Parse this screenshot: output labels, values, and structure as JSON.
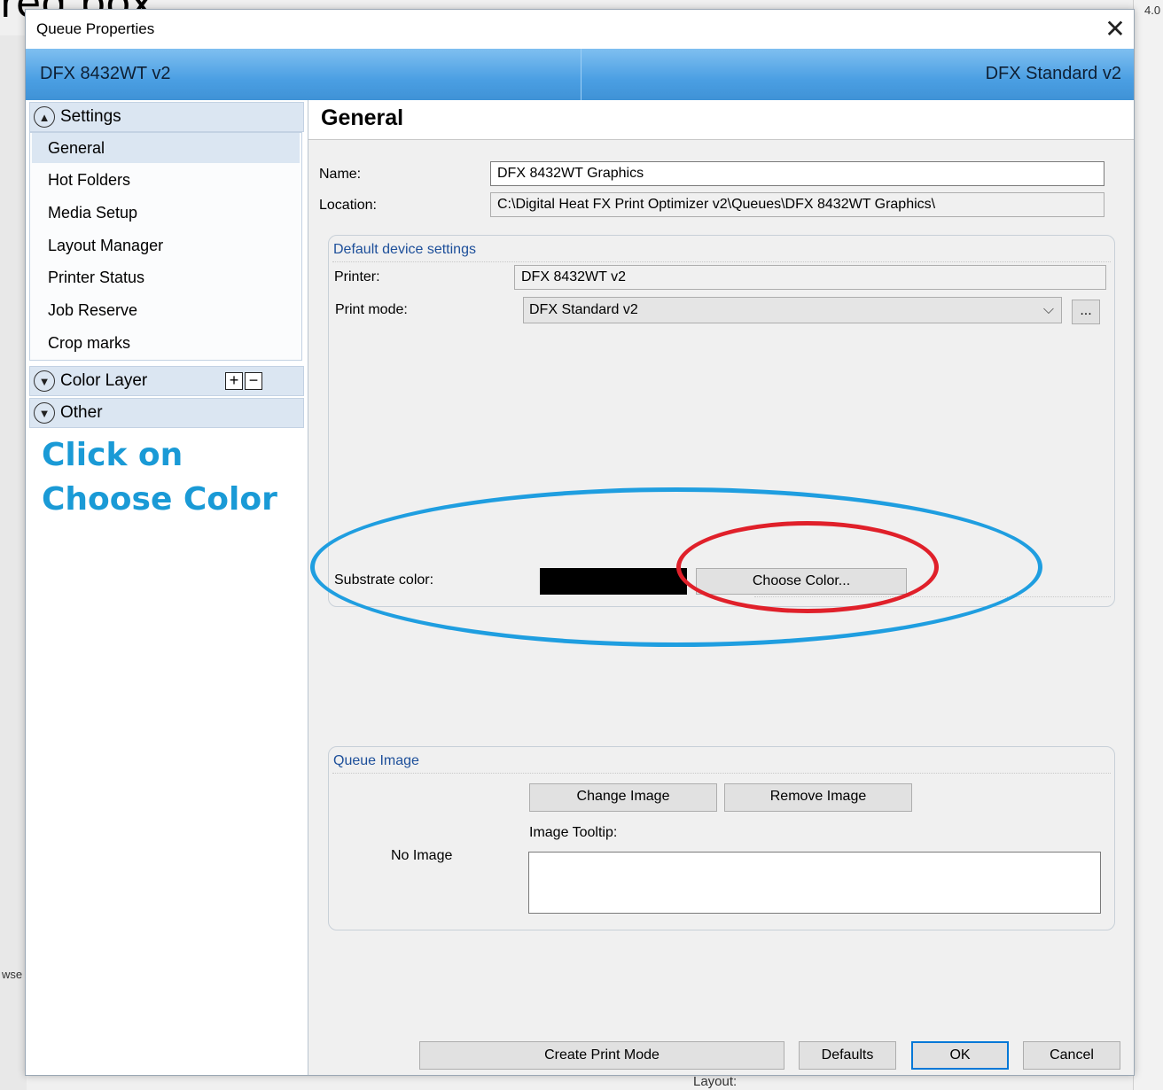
{
  "background": {
    "caption_fragment": "red box.",
    "right_corner_text": "4.0",
    "left_edge_text": "wse",
    "bottom_text": "Layout:"
  },
  "dialog": {
    "title": "Queue Properties",
    "close_glyph": "✕",
    "header": {
      "left": "DFX 8432WT v2",
      "right": "DFX Standard v2"
    }
  },
  "nav": {
    "settings": {
      "label": "Settings",
      "items": [
        "General",
        "Hot Folders",
        "Media Setup",
        "Layout Manager",
        "Printer Status",
        "Job Reserve",
        "Crop marks"
      ],
      "selected": "General"
    },
    "color_layer": {
      "label": "Color Layer",
      "plus": "+",
      "minus": "−"
    },
    "other": {
      "label": "Other"
    }
  },
  "instruction": "Click on Choose Color",
  "general": {
    "title": "General",
    "name_label": "Name:",
    "name_value": "DFX 8432WT Graphics",
    "location_label": "Location:",
    "location_value": "C:\\Digital Heat FX Print Optimizer v2\\Queues\\DFX 8432WT Graphics\\"
  },
  "device_settings": {
    "group_title": "Default device settings",
    "printer_label": "Printer:",
    "printer_value": "DFX 8432WT v2",
    "print_mode_label": "Print mode:",
    "print_mode_value": "DFX Standard v2",
    "print_mode_more": "...",
    "substrate_label": "Substrate color:",
    "substrate_color": "#000000",
    "choose_color_label": "Choose Color..."
  },
  "queue_image": {
    "group_title": "Queue Image",
    "change_label": "Change Image",
    "remove_label": "Remove Image",
    "tooltip_label": "Image Tooltip:",
    "no_image_label": "No Image",
    "tooltip_value": ""
  },
  "footer": {
    "create_print_mode": "Create Print Mode",
    "defaults": "Defaults",
    "ok": "OK",
    "cancel": "Cancel"
  },
  "annotation_colors": {
    "blue_ellipse": "#1f9ee0",
    "red_ellipse": "#e0202a",
    "instruction_text": "#1a9ad6"
  }
}
